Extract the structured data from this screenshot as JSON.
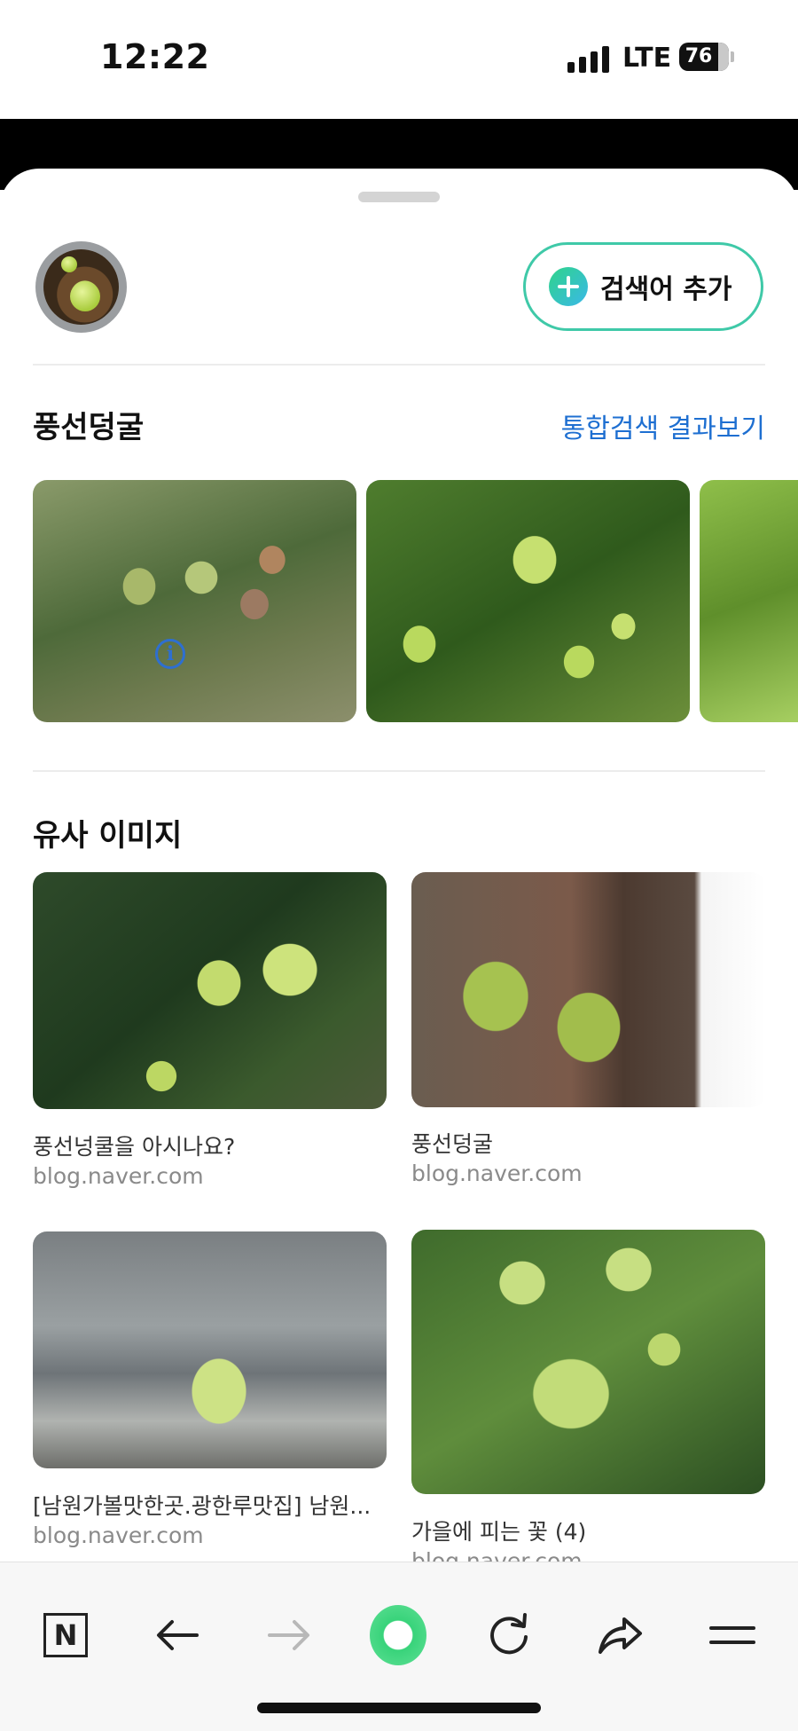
{
  "status_bar": {
    "time": "12:22",
    "network": "LTE",
    "battery": "76"
  },
  "header": {
    "add_keyword_label": "검색어 추가"
  },
  "result": {
    "title": "풍선덩굴",
    "link": "통합검색 결과보기",
    "images": [
      "balloon vine photo 1",
      "balloon vine photo 2",
      "balloon vine photo 3"
    ]
  },
  "similar": {
    "title": "유사 이미지",
    "info_icon": "i",
    "items": [
      {
        "title": "풍선넝쿨을 아시나요?",
        "source": "blog.naver.com"
      },
      {
        "title": "풍선덩굴",
        "source": "blog.naver.com"
      },
      {
        "title": "[남원가볼맛한곳.광한루맛집] 남원...",
        "source": "blog.naver.com"
      },
      {
        "title": "가을에 피는 꽃 (4)",
        "source": "blog.naver.com"
      }
    ]
  },
  "toolbar": {
    "home_label": "N",
    "icons": [
      "naver-home-icon",
      "back-arrow-icon",
      "forward-arrow-icon",
      "green-dot-icon",
      "reload-icon",
      "share-icon",
      "menu-icon"
    ]
  },
  "colors": {
    "link_blue": "#1e6fd1",
    "accent_green": "#3fc9a8"
  }
}
